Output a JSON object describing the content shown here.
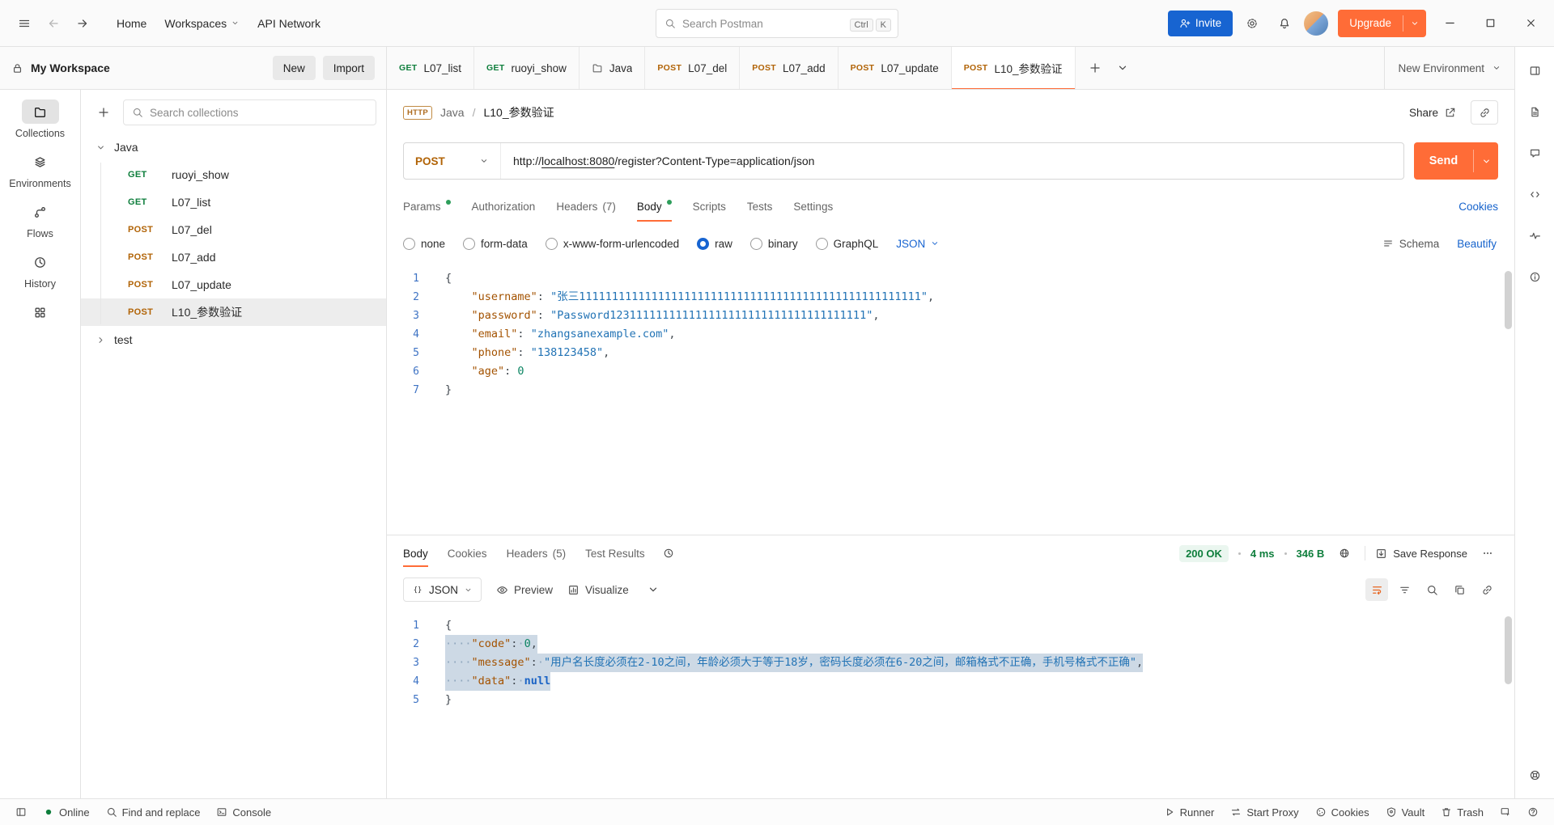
{
  "topbar": {
    "nav": [
      {
        "label": "Home",
        "chevron": false
      },
      {
        "label": "Workspaces",
        "chevron": true
      },
      {
        "label": "API Network",
        "chevron": false
      }
    ],
    "search": {
      "placeholder": "Search Postman",
      "keys": [
        "Ctrl",
        "K"
      ]
    },
    "invite_label": "Invite",
    "upgrade_label": "Upgrade"
  },
  "workspace_bar": {
    "title": "My Workspace",
    "new_label": "New",
    "import_label": "Import"
  },
  "request_tabs": [
    {
      "method": "GET",
      "label": "L07_list"
    },
    {
      "method": "GET",
      "label": "ruoyi_show"
    },
    {
      "method": "",
      "icon": "collection",
      "label": "Java"
    },
    {
      "method": "POST",
      "label": "L07_del"
    },
    {
      "method": "POST",
      "label": "L07_add"
    },
    {
      "method": "POST",
      "label": "L07_update"
    },
    {
      "method": "POST",
      "label": "L10_参数验证",
      "active": true
    }
  ],
  "environment_selector_label": "New Environment",
  "nav_rail": [
    {
      "icon": "collections",
      "label": "Collections",
      "active": true
    },
    {
      "icon": "environments",
      "label": "Environments"
    },
    {
      "icon": "flows",
      "label": "Flows"
    },
    {
      "icon": "history",
      "label": "History"
    },
    {
      "icon": "apps",
      "label": ""
    }
  ],
  "sidebar": {
    "search_placeholder": "Search collections",
    "tree": [
      {
        "label": "Java",
        "expanded": true,
        "children": [
          {
            "method": "GET",
            "label": "ruoyi_show"
          },
          {
            "method": "GET",
            "label": "L07_list"
          },
          {
            "method": "POST",
            "label": "L07_del"
          },
          {
            "method": "POST",
            "label": "L07_add"
          },
          {
            "method": "POST",
            "label": "L07_update"
          },
          {
            "method": "POST",
            "label": "L10_参数验证",
            "selected": true
          }
        ]
      },
      {
        "label": "test",
        "expanded": false,
        "children": []
      }
    ]
  },
  "request": {
    "breadcrumb": {
      "protocol": "HTTP",
      "collection": "Java",
      "separator": "/",
      "name": "L10_参数验证"
    },
    "share_label": "Share",
    "method": "POST",
    "url_pre": "http://",
    "url_host": "localhost:8080",
    "url_rest": "/register?Content-Type=application/json",
    "send_label": "Send",
    "tabs": [
      {
        "label": "Params",
        "dot": true
      },
      {
        "label": "Authorization"
      },
      {
        "label": "Headers",
        "count": "(7)"
      },
      {
        "label": "Body",
        "dot": true,
        "active": true
      },
      {
        "label": "Scripts"
      },
      {
        "label": "Tests"
      },
      {
        "label": "Settings"
      }
    ],
    "cookies_label": "Cookies",
    "body_types": [
      "none",
      "form-data",
      "x-www-form-urlencoded",
      "raw",
      "binary",
      "GraphQL"
    ],
    "body_type_selected": "raw",
    "raw_language": "JSON",
    "schema_label": "Schema",
    "beautify_label": "Beautify",
    "editor_lines": [
      {
        "n": 1,
        "tokens": [
          [
            "pn",
            "{"
          ]
        ]
      },
      {
        "n": 2,
        "tokens": [
          [
            "ws",
            "    "
          ],
          [
            "ky",
            "\"username\""
          ],
          [
            "pn",
            ": "
          ],
          [
            "st",
            "\"张三1111111111111111111111111111111111111111111111111111\""
          ],
          [
            "pn",
            ","
          ]
        ]
      },
      {
        "n": 3,
        "tokens": [
          [
            "ws",
            "    "
          ],
          [
            "ky",
            "\"password\""
          ],
          [
            "pn",
            ": "
          ],
          [
            "st",
            "\"Password123111111111111111111111111111111111111\""
          ],
          [
            "pn",
            ","
          ]
        ]
      },
      {
        "n": 4,
        "tokens": [
          [
            "ws",
            "    "
          ],
          [
            "ky",
            "\"email\""
          ],
          [
            "pn",
            ": "
          ],
          [
            "st",
            "\"zhangsanexample.com\""
          ],
          [
            "pn",
            ","
          ]
        ]
      },
      {
        "n": 5,
        "tokens": [
          [
            "ws",
            "    "
          ],
          [
            "ky",
            "\"phone\""
          ],
          [
            "pn",
            ": "
          ],
          [
            "st",
            "\"138123458\""
          ],
          [
            "pn",
            ","
          ]
        ]
      },
      {
        "n": 6,
        "tokens": [
          [
            "ws",
            "    "
          ],
          [
            "ky",
            "\"age\""
          ],
          [
            "pn",
            ": "
          ],
          [
            "nu",
            "0"
          ]
        ]
      },
      {
        "n": 7,
        "tokens": [
          [
            "pn",
            "}"
          ]
        ]
      }
    ]
  },
  "response": {
    "tabs": [
      {
        "label": "Body",
        "active": true
      },
      {
        "label": "Cookies"
      },
      {
        "label": "Headers",
        "count": "(5)"
      },
      {
        "label": "Test Results"
      }
    ],
    "status": "200 OK",
    "time": "4 ms",
    "size": "346 B",
    "save_label": "Save Response",
    "language": "JSON",
    "preview_label": "Preview",
    "visualize_label": "Visualize",
    "editor_lines": [
      {
        "n": 1,
        "tokens": [
          [
            "pn",
            "{"
          ]
        ]
      },
      {
        "n": 2,
        "sel": true,
        "tokens": [
          [
            "wd",
            "····"
          ],
          [
            "ky",
            "\"code\""
          ],
          [
            "pn",
            ":"
          ],
          [
            "wd",
            "·"
          ],
          [
            "nu",
            "0"
          ],
          [
            "pn",
            ","
          ]
        ]
      },
      {
        "n": 3,
        "sel": true,
        "tokens": [
          [
            "wd",
            "····"
          ],
          [
            "ky",
            "\"message\""
          ],
          [
            "pn",
            ":"
          ],
          [
            "wd",
            "·"
          ],
          [
            "st",
            "\"用户名长度必须在2-10之间，年龄必须大于等于18岁，密码长度必须在6-20之间，邮箱格式不正确，手机号格式不正确\""
          ],
          [
            "pn",
            ","
          ]
        ]
      },
      {
        "n": 4,
        "sel": true,
        "tokens": [
          [
            "wd",
            "····"
          ],
          [
            "ky",
            "\"data\""
          ],
          [
            "pn",
            ":"
          ],
          [
            "wd",
            "·"
          ],
          [
            "nl",
            "null"
          ]
        ]
      },
      {
        "n": 5,
        "tokens": [
          [
            "pn",
            "}"
          ]
        ]
      }
    ]
  },
  "statusbar": {
    "left": [
      {
        "icon": "panel",
        "label": ""
      },
      {
        "icon": "online-dot",
        "label": "Online"
      },
      {
        "icon": "search",
        "label": "Find and replace"
      },
      {
        "icon": "console",
        "label": "Console"
      }
    ],
    "right": [
      {
        "icon": "runner",
        "label": "Runner"
      },
      {
        "icon": "proxy",
        "label": "Start Proxy"
      },
      {
        "icon": "cookie",
        "label": "Cookies"
      },
      {
        "icon": "vault",
        "label": "Vault"
      },
      {
        "icon": "trash",
        "label": "Trash"
      },
      {
        "icon": "select-window",
        "label": ""
      },
      {
        "icon": "help",
        "label": ""
      }
    ]
  },
  "right_rail": {
    "top": [
      "layout",
      "file-text",
      "comment",
      "code",
      "pulse",
      "info"
    ],
    "bottom": [
      "lifebuoy"
    ]
  }
}
